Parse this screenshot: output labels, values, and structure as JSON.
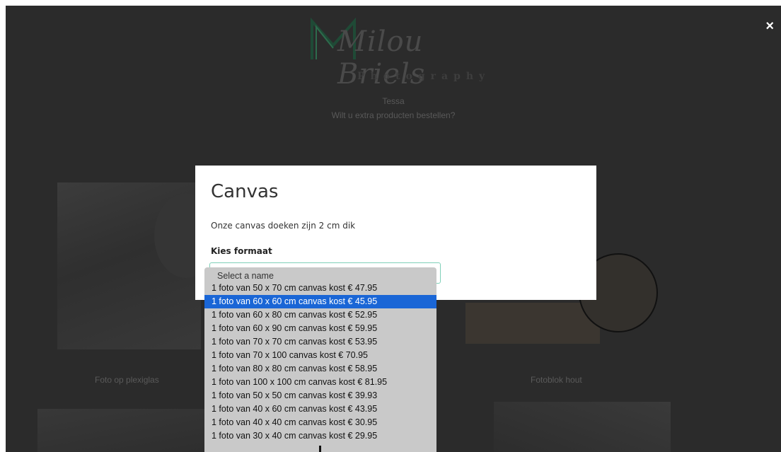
{
  "header": {
    "logo_script": "Milou Briels",
    "logo_sub": "Photography",
    "customer_name": "Tessa",
    "question": "Wilt u extra producten bestellen?"
  },
  "background_captions": {
    "left": "Foto op plexiglas",
    "right": "Fotoblok hout"
  },
  "close_icon": "×",
  "modal": {
    "title": "Canvas",
    "description": "Onze canvas doeken zijn 2 cm dik",
    "format_label": "Kies formaat"
  },
  "dropdown": {
    "placeholder": "Select a name",
    "selected_index": 1,
    "options": [
      "1 foto van 50 x 70 cm canvas kost € 47.95",
      "1 foto van 60 x 60 cm canvas kost € 45.95",
      "1 foto van 60 x 80 cm canvas kost € 52.95",
      "1 foto van 60 x 90 cm canvas kost € 59.95",
      "1 foto van 70 x 70 cm canvas kost € 53.95",
      "1 foto van 70 x 100 canvas kost € 70.95",
      "1 foto van 80 x 80 cm canvas kost € 58.95",
      "1 foto van 100 x 100 cm canvas kost € 81.95",
      "1 foto van 50 x 50 cm canvas kost € 39.93",
      "1 foto van 40 x 60 cm canvas kost € 43.95",
      "1 foto van 40 x 40 cm canvas kost € 30.95",
      "1 foto van 30 x 40 cm canvas kost € 29.95"
    ]
  },
  "colors": {
    "overlay": "#2b2b2b",
    "selected_option": "#1a66d6",
    "select_border": "#7fd0b8",
    "logo_green": "#1f5a3e"
  }
}
